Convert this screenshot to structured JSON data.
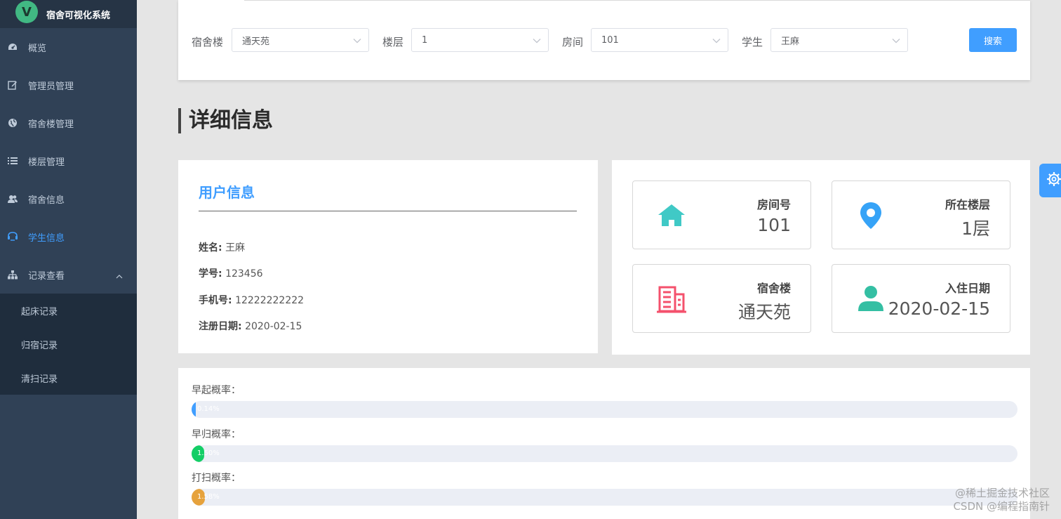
{
  "app": {
    "title": "宿舍可视化系统",
    "logo_letter": "V"
  },
  "sidebar": {
    "items": [
      {
        "label": "概览",
        "icon": "dashboard-icon"
      },
      {
        "label": "管理员管理",
        "icon": "edit-icon"
      },
      {
        "label": "宿舍楼管理",
        "icon": "globe-icon"
      },
      {
        "label": "楼层管理",
        "icon": "list-icon"
      },
      {
        "label": "宿舍信息",
        "icon": "users-icon"
      },
      {
        "label": "学生信息",
        "icon": "student-icon",
        "active": true
      },
      {
        "label": "记录查看",
        "icon": "sitemap-icon",
        "expanded": true
      }
    ],
    "submenu": [
      {
        "label": "起床记录"
      },
      {
        "label": "归宿记录"
      },
      {
        "label": "清扫记录"
      }
    ]
  },
  "search": {
    "building_label": "宿舍楼",
    "building_value": "通天苑",
    "floor_label": "楼层",
    "floor_value": "1",
    "room_label": "房间",
    "room_value": "101",
    "student_label": "学生",
    "student_value": "王麻",
    "button_label": "搜索"
  },
  "section_title": "详细信息",
  "user_info": {
    "title": "用户信息",
    "name_label": "姓名:",
    "name_value": "王麻",
    "id_label": "学号:",
    "id_value": "123456",
    "phone_label": "手机号:",
    "phone_value": "12222222222",
    "reg_label": "注册日期:",
    "reg_value": "2020-02-15"
  },
  "stats": {
    "room": {
      "label": "房间号",
      "value": "101",
      "icon": "home-icon",
      "color": "#40c9c6"
    },
    "floor": {
      "label": "所在楼层",
      "value": "1层",
      "icon": "location-pin-icon",
      "color": "#36a3f7"
    },
    "building": {
      "label": "宿舍楼",
      "value": "通天苑",
      "icon": "building-icon",
      "color": "#f4516c"
    },
    "checkin": {
      "label": "入住日期",
      "value": "2020-02-15",
      "icon": "user-icon",
      "color": "#34bfa3"
    }
  },
  "progress": [
    {
      "label": "早起概率：",
      "text": "0.14%",
      "percent": 0.14,
      "color": "#409eff"
    },
    {
      "label": "早归概率：",
      "text": "1.50%",
      "percent": 1.5,
      "color": "#13ce66"
    },
    {
      "label": "打扫概率：",
      "text": "1.58%",
      "percent": 1.58,
      "color": "#e6a23c"
    }
  ],
  "colors": {
    "sidebar_bg": "#304156",
    "submenu_bg": "#1f2d3d",
    "accent": "#409eff"
  },
  "watermark": {
    "line1": "@稀土掘金技术社区",
    "line2": "CSDN @编程指南针"
  }
}
